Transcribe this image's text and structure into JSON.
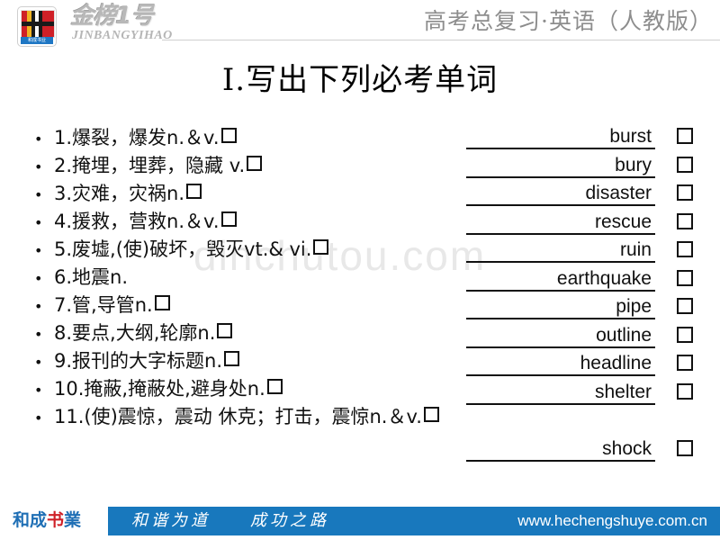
{
  "header": {
    "brand_cn": "金榜1号",
    "brand_en": "JINBANGYIHAO",
    "logo_monogram": "HC",
    "logo_caption": "和成书业",
    "course_title": "高考总复习·英语（人教版）"
  },
  "slide": {
    "title": "Ⅰ.写出下列必考单词",
    "watermark": "dinchutou.com",
    "bullet": "•",
    "questions": [
      {
        "number": "1.",
        "text": "爆裂，爆发n.＆v."
      },
      {
        "number": "2.",
        "text": "掩埋，埋葬，隐藏 v."
      },
      {
        "number": "3.",
        "text": "灾难，灾祸n."
      },
      {
        "number": "4.",
        "text": "援救，营救n.＆v."
      },
      {
        "number": "5.",
        "text": "废墟,(使)破坏，毁灭vt.& vi."
      },
      {
        "number": "6.",
        "text": "地震n.",
        "has_box": false
      },
      {
        "number": "7.",
        "text": "管,导管n."
      },
      {
        "number": "8.",
        "text": "要点,大纲,轮廓n."
      },
      {
        "number": "9.",
        "text": "报刊的大字标题n."
      },
      {
        "number": "10.",
        "text": "掩蔽,掩蔽处,避身处n."
      },
      {
        "number": "11.",
        "text": "(使)震惊，震动 休克；打击，震惊n.＆v."
      }
    ],
    "answers": [
      "burst",
      "bury",
      "disaster",
      "rescue",
      "ruin",
      "earthquake",
      "pipe",
      "outline",
      "headline",
      "shelter",
      "shock"
    ]
  },
  "footer": {
    "logo_he": "和成",
    "logo_shu": "书",
    "logo_ye": "業",
    "slogan": "和谐为道　　成功之路",
    "url": "www.hechengshuye.com.cn"
  },
  "colors": {
    "footer_blue": "#1878bd",
    "brand_red": "#cf2027",
    "header_gray": "#8d8d8d"
  }
}
